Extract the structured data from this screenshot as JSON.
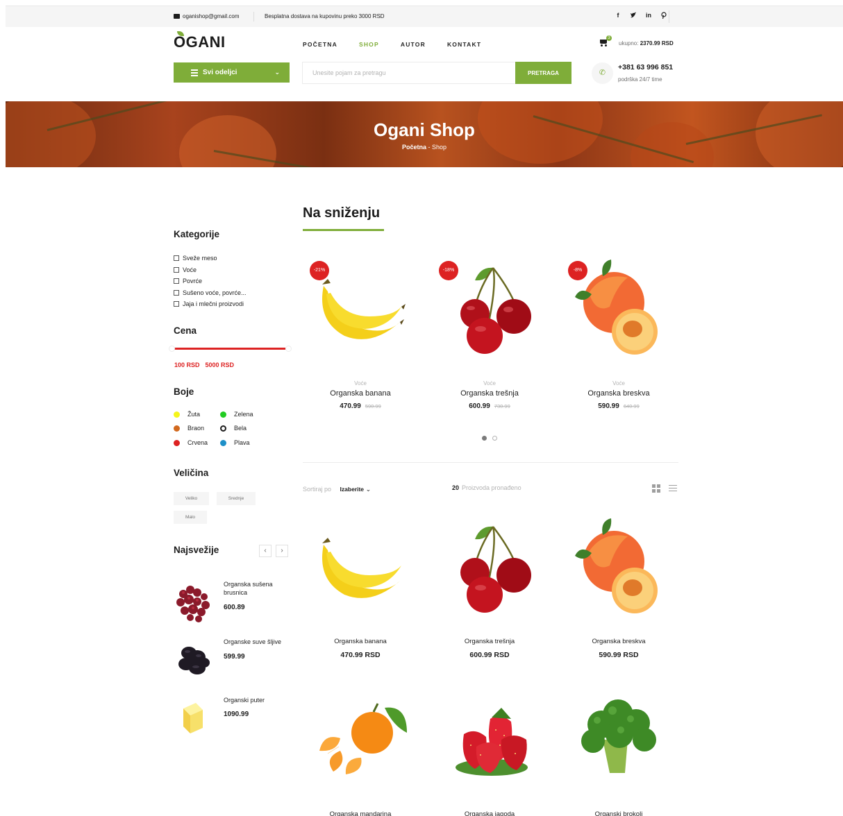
{
  "topbar": {
    "email": "oganishop@gmail.com",
    "shipping": "Besplatna dostava na kupovinu preko 3000 RSD",
    "social": [
      "f",
      "t",
      "in",
      "p"
    ]
  },
  "header": {
    "logo": "OGANI",
    "nav": [
      "POČETNA",
      "SHOP",
      "AUTOR",
      "KONTAKT"
    ],
    "active_nav": "SHOP",
    "cart_count": "3",
    "total_label": "ukupno:",
    "total_value": "2370.99 RSD"
  },
  "hero": {
    "categories_button": "Svi odeljci",
    "search_placeholder": "Unesite pojam za pretragu",
    "search_button": "PRETRAGA",
    "phone": "+381 63 996 851",
    "phone_sub": "podrška 24/7 time"
  },
  "banner": {
    "title": "Ogani Shop",
    "crumb_home": "Početna",
    "crumb_sep": "-",
    "crumb_current": "Shop"
  },
  "sidebar": {
    "categories_title": "Kategorije",
    "categories": [
      "Sveže meso",
      "Voće",
      "Povrće",
      "Sušeno voće, povrće...",
      "Jaja i mlečni proizvodi"
    ],
    "price_title": "Cena",
    "price_min": "100 RSD",
    "price_max": "5000 RSD",
    "colors_title": "Boje",
    "colors": [
      {
        "name": "Žuta",
        "color": "#f5f51a"
      },
      {
        "name": "Zelena",
        "color": "#22cc22"
      },
      {
        "name": "Braon",
        "color": "#d2691e"
      },
      {
        "name": "Bela",
        "color": "#ffffff"
      },
      {
        "name": "Crvena",
        "color": "#dd2222"
      },
      {
        "name": "Plava",
        "color": "#1e90c8"
      }
    ],
    "size_title": "Veličina",
    "sizes": [
      "Veliko",
      "Srednje",
      "Malo"
    ],
    "latest_title": "Najsvežije",
    "latest": [
      {
        "name": "Organska sušena brusnica",
        "price": "600.89"
      },
      {
        "name": "Organske suve šljive",
        "price": "599.99"
      },
      {
        "name": "Organski puter",
        "price": "1090.99"
      }
    ]
  },
  "sale": {
    "title": "Na sniženju",
    "items": [
      {
        "discount": "-21%",
        "category": "Voće",
        "name": "Organska banana",
        "price": "470.99",
        "old_price": "590.99",
        "icon": "banana"
      },
      {
        "discount": "-18%",
        "category": "Voće",
        "name": "Organska trešnja",
        "price": "600.99",
        "old_price": "730.99",
        "icon": "cherry"
      },
      {
        "discount": "-8%",
        "category": "Voće",
        "name": "Organska breskva",
        "price": "590.99",
        "old_price": "640.99",
        "icon": "peach"
      }
    ]
  },
  "toolbar": {
    "sort_label": "Sortiraj po",
    "sort_value": "Izaberite",
    "found_count": "20",
    "found_label": "Proizvoda pronađeno"
  },
  "products": [
    {
      "name": "Organska banana",
      "price": "470.99 RSD",
      "icon": "banana"
    },
    {
      "name": "Organska trešnja",
      "price": "600.99 RSD",
      "icon": "cherry"
    },
    {
      "name": "Organska breskva",
      "price": "590.99 RSD",
      "icon": "peach"
    },
    {
      "name": "Organska mandarina",
      "price": "",
      "icon": "tangerine"
    },
    {
      "name": "Organska jagoda",
      "price": "",
      "icon": "strawberry"
    },
    {
      "name": "Organski brokoli",
      "price": "",
      "icon": "broccoli"
    }
  ],
  "theme": {
    "accent": "#7fad39",
    "sale": "#dd2222"
  }
}
